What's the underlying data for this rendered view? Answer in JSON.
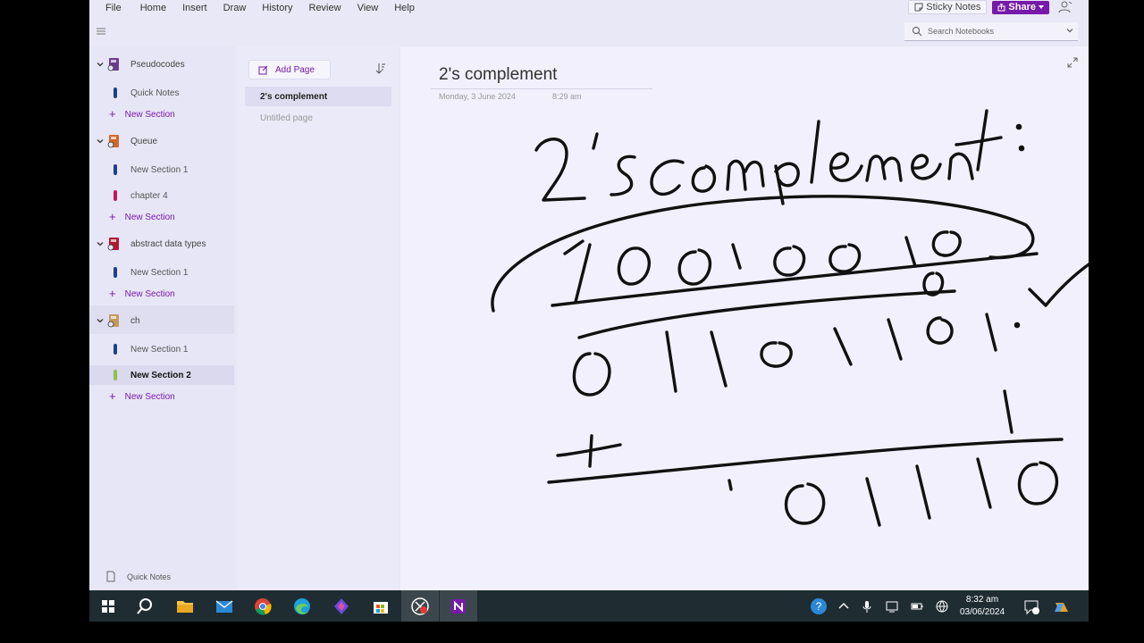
{
  "menu": [
    "File",
    "Home",
    "Insert",
    "Draw",
    "History",
    "Review",
    "View",
    "Help"
  ],
  "sticky_notes_label": "Sticky Notes",
  "share_label": "Share",
  "search": {
    "placeholder": "Search Notebooks"
  },
  "notebooks": [
    {
      "name": "Pseudocodes",
      "color": "#6b3b8f",
      "sections": [
        {
          "label": "Quick Notes",
          "color": "#1e3f8a"
        }
      ],
      "new_section": "New Section"
    },
    {
      "name": "Queue",
      "color": "#d0682a",
      "sections": [
        {
          "label": "New Section 1",
          "color": "#1e3f8a"
        },
        {
          "label": "chapter 4",
          "color": "#c2185b"
        }
      ],
      "new_section": "New Section"
    },
    {
      "name": "abstract data types",
      "color": "#b3182f",
      "sections": [
        {
          "label": "New Section 1",
          "color": "#1e3f8a"
        }
      ],
      "new_section": "New Section"
    },
    {
      "name": "ch",
      "color": "#c49a5c",
      "sections": [
        {
          "label": "New Section 1",
          "color": "#1e3f8a"
        },
        {
          "label": "New Section 2",
          "color": "#8bc34a"
        }
      ],
      "new_section": "New Section"
    }
  ],
  "footer_quick_notes": "Quick Notes",
  "add_page_label": "Add Page",
  "pages": [
    {
      "label": "2's complement",
      "selected": true
    },
    {
      "label": "Untitled page",
      "selected": false
    }
  ],
  "page": {
    "title": "2's complement",
    "date": "Monday, 3 June 2024",
    "time": "8:29 am"
  },
  "clock": {
    "time": "8:32 am",
    "date": "03/06/2024"
  },
  "accent_color": "#7719aa"
}
